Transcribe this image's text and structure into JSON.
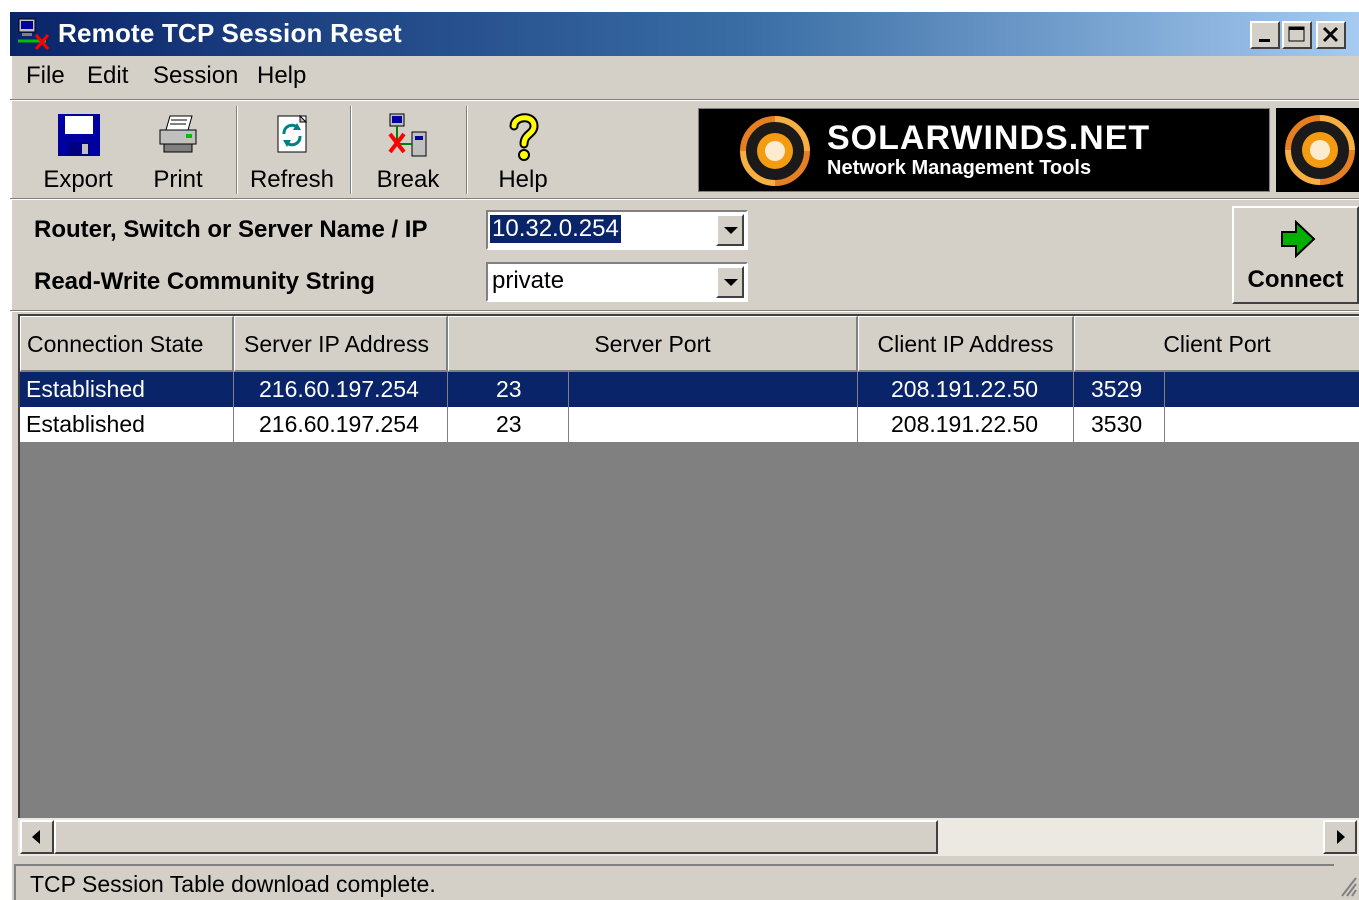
{
  "window": {
    "title": "Remote TCP Session Reset",
    "controls": [
      "minimize",
      "maximize",
      "close"
    ]
  },
  "menu": [
    "File",
    "Edit",
    "Session",
    "Help"
  ],
  "toolbar": [
    {
      "label": "Export",
      "icon": "floppy-disk-icon"
    },
    {
      "label": "Print",
      "icon": "printer-icon"
    },
    {
      "label": "Refresh",
      "icon": "refresh-icon"
    },
    {
      "label": "Break",
      "icon": "break-connection-icon"
    },
    {
      "label": "Help",
      "icon": "question-mark-icon"
    }
  ],
  "banner": {
    "brand": "SOLARWINDS.NET",
    "tagline": "Network Management Tools"
  },
  "form": {
    "router_label": "Router, Switch or Server Name / IP",
    "router_value": "10.32.0.254",
    "community_label": "Read-Write Community String",
    "community_value": "private",
    "connect_label": "Connect"
  },
  "table": {
    "columns": [
      "Connection State",
      "Server IP Address",
      "Server Port",
      "Client IP Address",
      "Client Port"
    ],
    "rows": [
      {
        "state": "Established",
        "server_ip": "216.60.197.254",
        "server_port": "23",
        "client_ip": "208.191.22.50",
        "client_port": "3529",
        "selected": true
      },
      {
        "state": "Established",
        "server_ip": "216.60.197.254",
        "server_port": "23",
        "client_ip": "208.191.22.50",
        "client_port": "3530",
        "selected": false
      }
    ]
  },
  "status": "TCP Session Table download complete.",
  "colors": {
    "title_start": "#0a246a",
    "title_end": "#a6caf0",
    "selection": "#0a246a",
    "chrome": "#d4d0c8",
    "empty_grid": "#808080"
  }
}
